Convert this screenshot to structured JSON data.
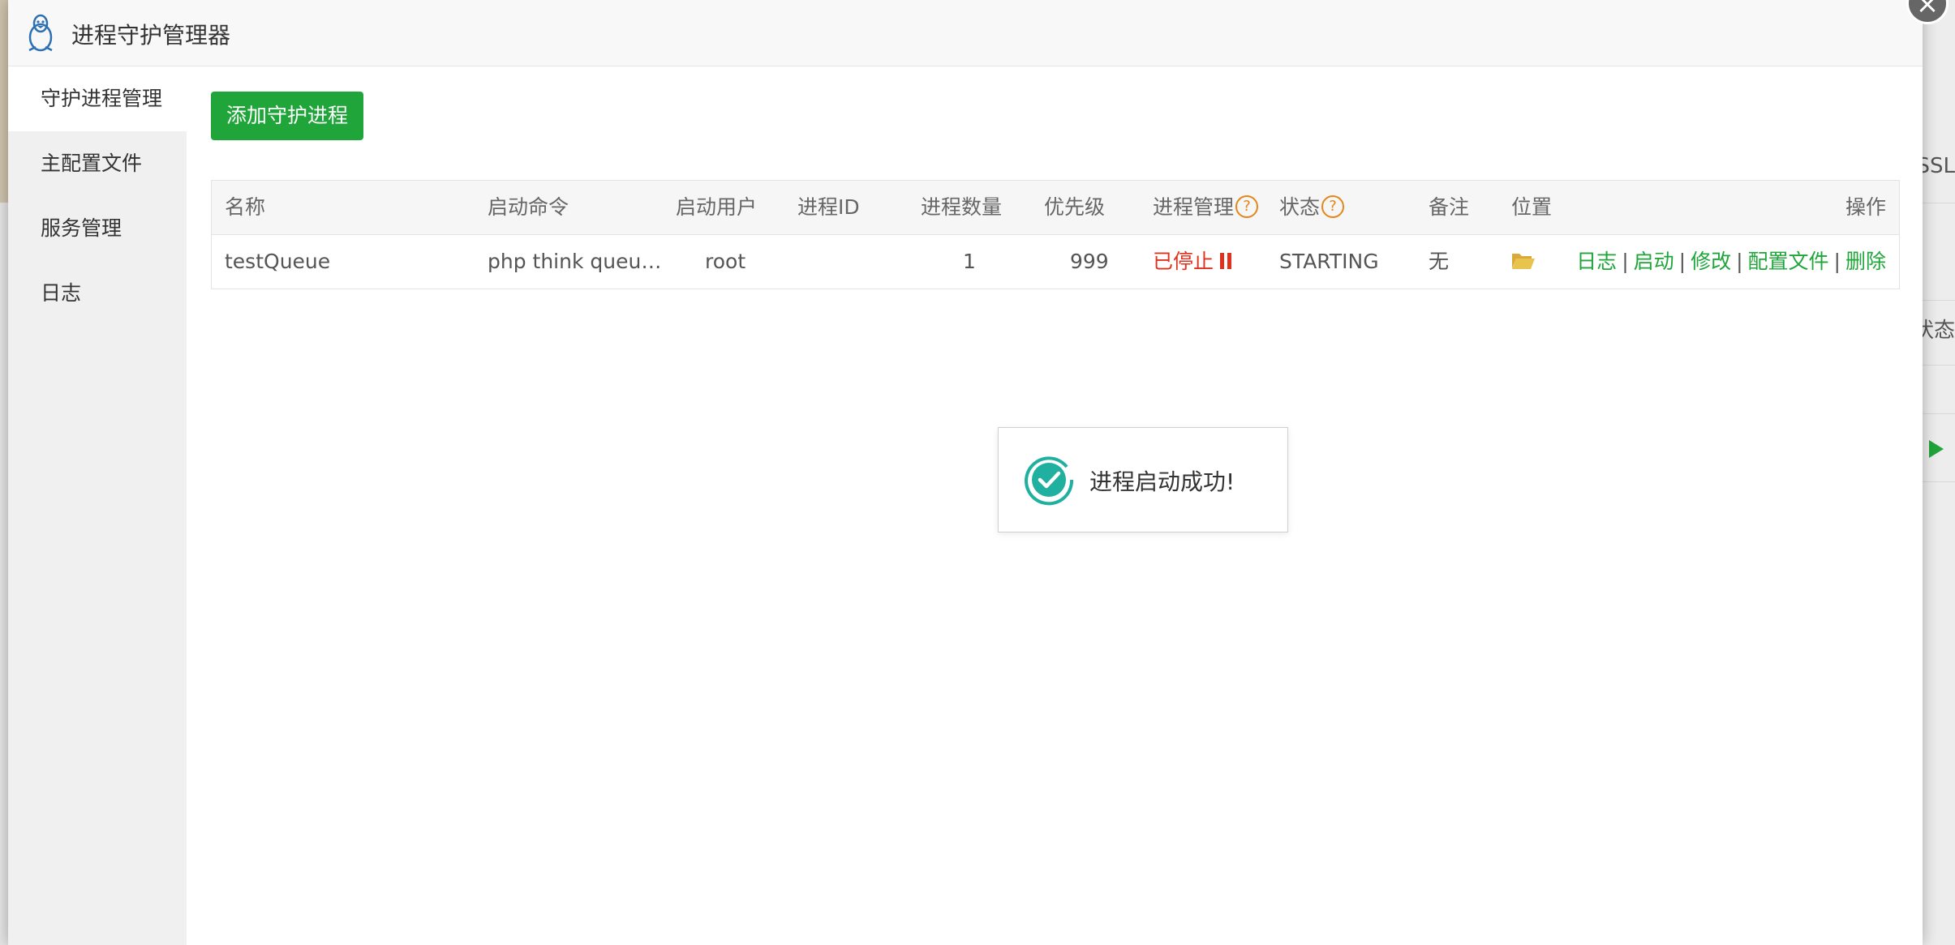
{
  "window": {
    "title": "进程守护管理器"
  },
  "sidebar": {
    "items": [
      {
        "label": "守护进程管理",
        "active": true
      },
      {
        "label": "主配置文件"
      },
      {
        "label": "服务管理"
      },
      {
        "label": "日志"
      }
    ]
  },
  "toolbar": {
    "add_label": "添加守护进程"
  },
  "table": {
    "headers": {
      "name": "名称",
      "command": "启动命令",
      "user": "启动用户",
      "pid": "进程ID",
      "count": "进程数量",
      "priority": "优先级",
      "manage": "进程管理",
      "status": "状态",
      "remark": "备注",
      "location": "位置",
      "actions": "操作"
    },
    "rows": [
      {
        "name": "testQueue",
        "command": "php think queu…",
        "user": "root",
        "pid": "",
        "count": "1",
        "priority": "999",
        "manage": "已停止",
        "status": "STARTING",
        "remark": "无",
        "actions": {
          "log": "日志",
          "start": "启动",
          "edit": "修改",
          "config": "配置文件",
          "delete": "删除",
          "separator": "|"
        }
      }
    ]
  },
  "toast": {
    "message": "进程启动成功!"
  },
  "background": {
    "text_1": "SSL",
    "text_2": "状态"
  },
  "colors": {
    "primary_green": "#20a53a",
    "stopped_red": "#e0301e",
    "help_orange": "#e5861b",
    "folder_yellow": "#e8c34d"
  },
  "icons": {
    "help": "question-circle-icon",
    "folder": "folder-open-icon",
    "pause": "pause-icon",
    "success": "check-circle-icon"
  }
}
